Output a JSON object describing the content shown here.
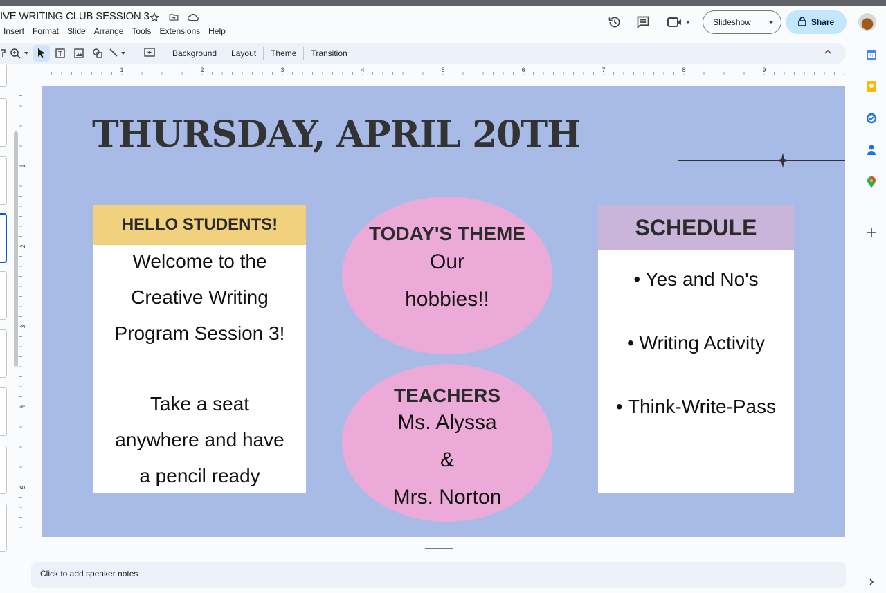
{
  "document": {
    "title": "IVE WRITING CLUB SESSION 3"
  },
  "menu": [
    "Insert",
    "Format",
    "Slide",
    "Arrange",
    "Tools",
    "Extensions",
    "Help"
  ],
  "header": {
    "slideshow_label": "Slideshow",
    "share_label": "Share"
  },
  "toolbar": {
    "background_label": "Background",
    "layout_label": "Layout",
    "theme_label": "Theme",
    "transition_label": "Transition"
  },
  "ruler": {
    "h_marks": [
      "1",
      "2",
      "3",
      "4",
      "5",
      "6",
      "7",
      "8",
      "9"
    ],
    "v_marks": [
      "1",
      "2",
      "3",
      "4",
      "5"
    ]
  },
  "slide": {
    "title": "THURSDAY, APRIL 20TH",
    "hello": {
      "heading": "HELLO STUDENTS!",
      "lines": [
        "Welcome to the",
        "Creative Writing",
        "Program Session 3!",
        "Take a seat",
        "anywhere and have",
        "a pencil ready"
      ]
    },
    "theme": {
      "heading": "TODAY'S THEME",
      "lines": [
        "Our",
        "hobbies!!"
      ]
    },
    "teachers": {
      "heading": "TEACHERS",
      "lines": [
        "Ms. Alyssa",
        "&",
        "Mrs. Norton"
      ]
    },
    "schedule": {
      "heading": "SCHEDULE",
      "items": [
        "• Yes and No's",
        "• Writing Activity",
        "• Think-Write-Pass"
      ]
    }
  },
  "notes": {
    "placeholder": "Click to add speaker notes"
  },
  "colors": {
    "slide_bg": "#a8bbe6",
    "hello_header": "#f1d17d",
    "schedule_header": "#c9b5d9",
    "ellipse": "#ebaad7",
    "share_bg": "#c2e7ff"
  },
  "icons": [
    "star-icon",
    "move-to-folder-icon",
    "cloud-saved-icon",
    "history-icon",
    "comment-icon",
    "video-call-icon",
    "lock-icon",
    "zoom-icon",
    "select-icon",
    "text-box-icon",
    "image-icon",
    "shape-icon",
    "line-icon",
    "add-comment-icon",
    "collapse-icon",
    "calendar-icon",
    "keep-icon",
    "tasks-icon",
    "contacts-icon",
    "maps-icon",
    "add-icon"
  ]
}
